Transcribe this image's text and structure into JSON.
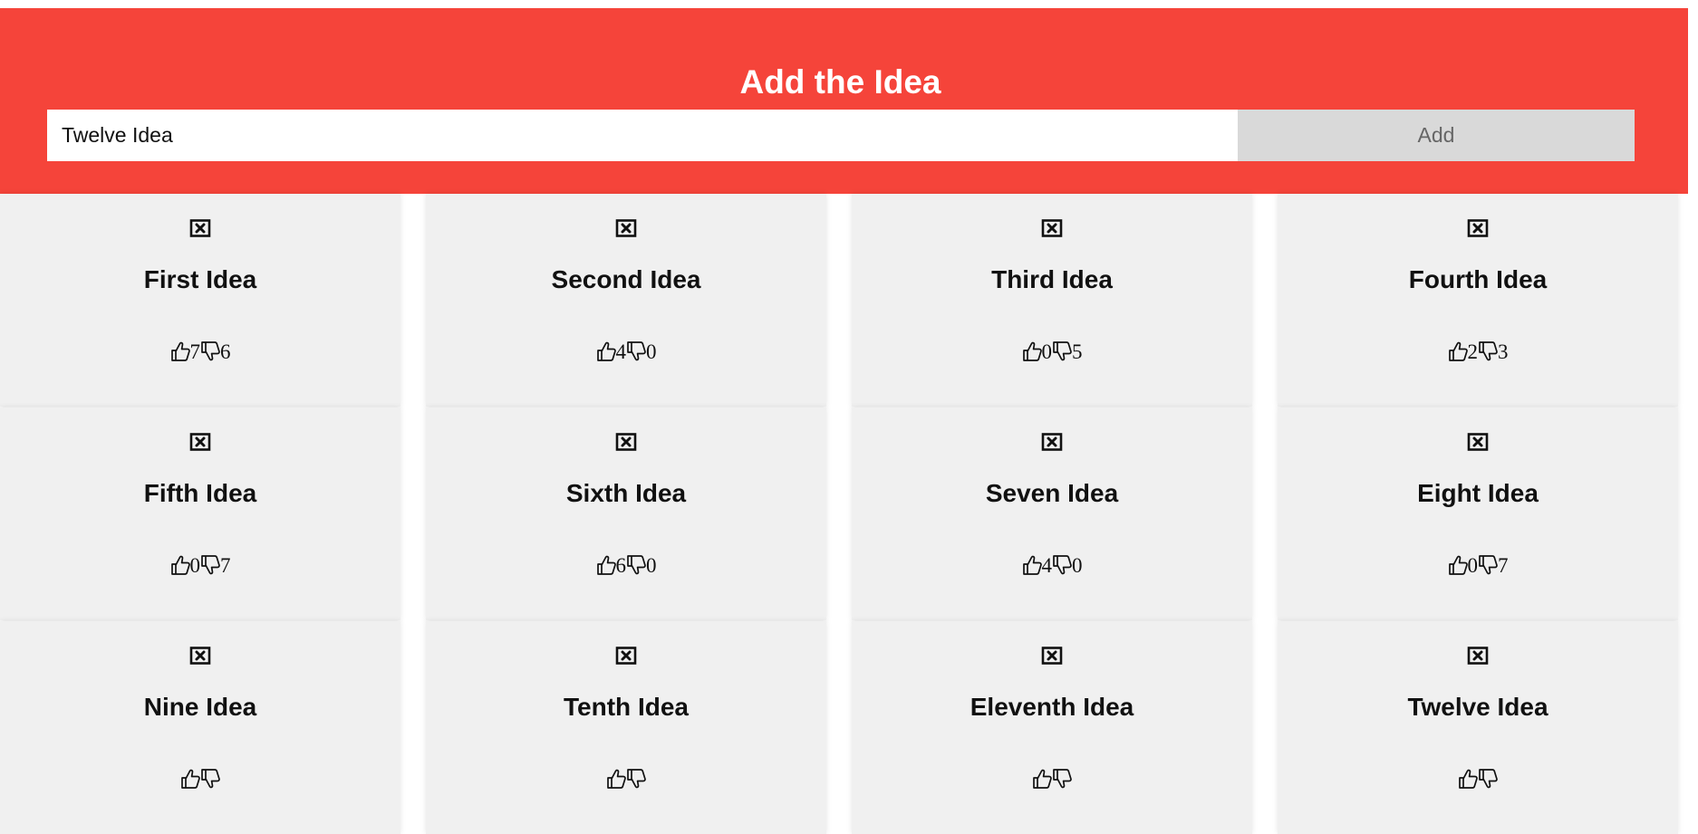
{
  "header": {
    "title": "Add the Idea",
    "input_value": "Twelve Idea",
    "add_label": "Add"
  },
  "ideas": [
    {
      "title": "First Idea",
      "up": "7",
      "down": "6"
    },
    {
      "title": "Second Idea",
      "up": "4",
      "down": "0"
    },
    {
      "title": "Third Idea",
      "up": "0",
      "down": "5"
    },
    {
      "title": "Fourth Idea",
      "up": "2",
      "down": "3"
    },
    {
      "title": "Fifth Idea",
      "up": "0",
      "down": "7"
    },
    {
      "title": "Sixth Idea",
      "up": "6",
      "down": "0"
    },
    {
      "title": "Seven Idea",
      "up": "4",
      "down": "0"
    },
    {
      "title": "Eight Idea",
      "up": "0",
      "down": "7"
    },
    {
      "title": "Nine Idea"
    },
    {
      "title": "Tenth Idea"
    },
    {
      "title": "Eleventh Idea"
    },
    {
      "title": "Twelve Idea"
    }
  ],
  "icons": {
    "close": "close-box-icon",
    "upvote": "thumbs-up-icon",
    "downvote": "thumbs-down-icon"
  },
  "colors": {
    "header_bg": "#f5443a",
    "card_bg": "#f0f0f0",
    "button_bg": "#d9d9d9"
  }
}
